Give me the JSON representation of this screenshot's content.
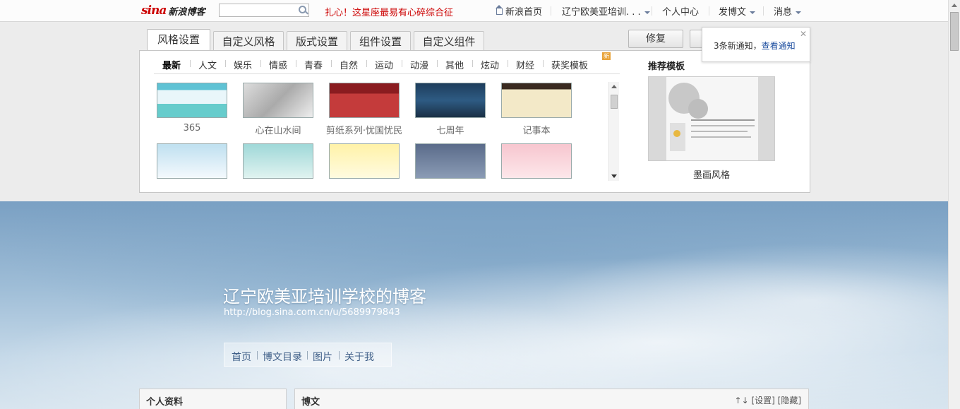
{
  "topbar": {
    "logo_sina": "sina",
    "logo_name": "新浪博客",
    "search_placeholder": "",
    "promo": "扎心！这星座最易有心碎综合征",
    "nav": {
      "home": "新浪首页",
      "blog_name": "辽宁欧美亚培训. . .",
      "personal": "个人中心",
      "post": "发博文",
      "messages": "消息"
    }
  },
  "settings": {
    "tabs": [
      "风格设置",
      "自定义风格",
      "版式设置",
      "组件设置",
      "自定义组件"
    ],
    "active_tab": 0,
    "repair_label": "修复",
    "categories": [
      "最新",
      "人文",
      "娱乐",
      "情感",
      "青春",
      "自然",
      "运动",
      "动漫",
      "其他",
      "炫动",
      "财经",
      "获奖模板"
    ],
    "new_badge": "新",
    "templates_row1": [
      "365",
      "心在山水间",
      "剪纸系列·忧国忧民",
      "七周年",
      "记事本"
    ],
    "recommend_title": "推荐模板",
    "recommend_label": "墨画风格"
  },
  "notice": {
    "text": "3条新通知，",
    "link": "查看通知",
    "close": "✕"
  },
  "blog": {
    "title": "辽宁欧美亚培训学校的博客",
    "url": "http://blog.sina.com.cn/u/5689979843",
    "nav": [
      "首页",
      "博文目录",
      "图片",
      "关于我"
    ],
    "profile_title": "个人资料",
    "posts_title": "博文",
    "posts_tools": "↑↓ [设置] [隐藏]"
  }
}
